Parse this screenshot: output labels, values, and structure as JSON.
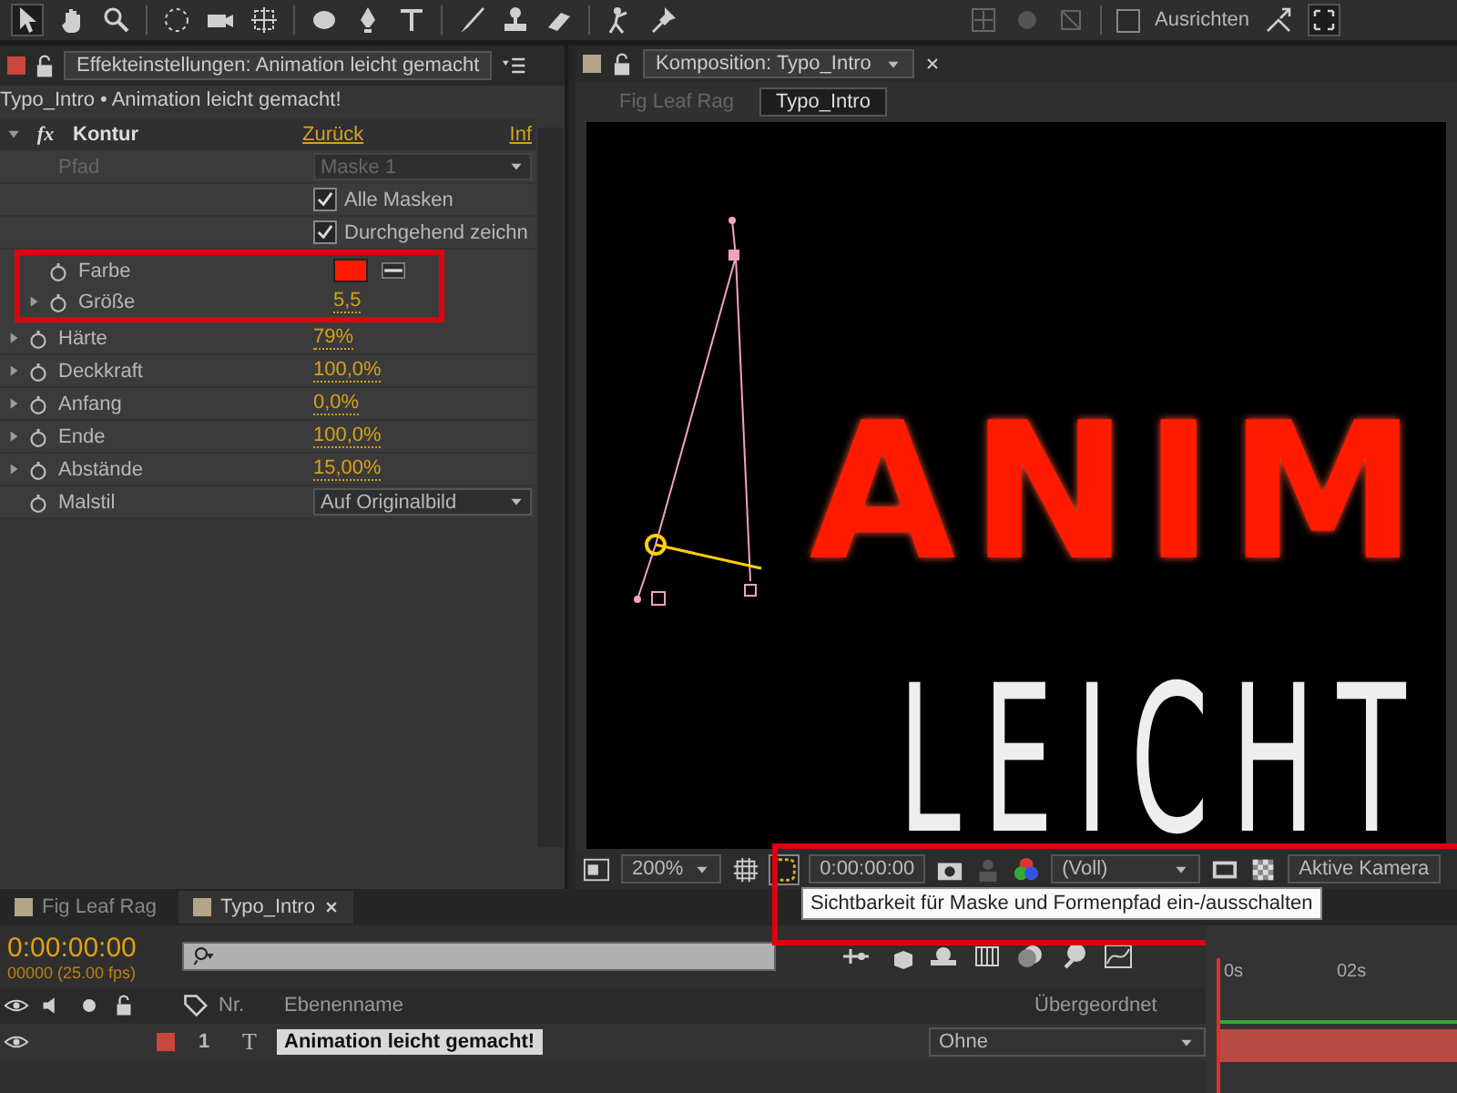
{
  "toolbar": {
    "align": {
      "label": "Ausrichten",
      "checked": false
    }
  },
  "effects_panel": {
    "tab": "Effekteinstellungen: Animation leicht gemacht",
    "breadcrumb": "Typo_Intro • Animation leicht gemacht!",
    "effect": {
      "fx_label": "fx",
      "name": "Kontur",
      "reset": "Zurück",
      "about": "Inf",
      "expanded": true
    },
    "rows": [
      {
        "kind": "dropdown",
        "label": "Pfad",
        "value": "Maske 1",
        "disabled": true,
        "stopwatch": false,
        "annotated": false
      },
      {
        "kind": "checkbox",
        "label": "Alle Masken",
        "checked": true,
        "stopwatch": false,
        "annotated": false
      },
      {
        "kind": "checkbox",
        "label": "Durchgehend zeichn",
        "checked": true,
        "stopwatch": false,
        "annotated": false
      },
      {
        "kind": "color",
        "label": "Farbe",
        "color": "#ff1a00",
        "stopwatch": true,
        "annotated": true
      },
      {
        "kind": "value",
        "label": "Größe",
        "value": "5,5",
        "stopwatch": true,
        "annotated": true
      },
      {
        "kind": "value",
        "label": "Härte",
        "value": "79%",
        "stopwatch": true,
        "annotated": false
      },
      {
        "kind": "value",
        "label": "Deckkraft",
        "value": "100,0%",
        "stopwatch": true,
        "annotated": false
      },
      {
        "kind": "value",
        "label": "Anfang",
        "value": "0,0%",
        "stopwatch": true,
        "annotated": false
      },
      {
        "kind": "value",
        "label": "Ende",
        "value": "100,0%",
        "stopwatch": true,
        "annotated": false
      },
      {
        "kind": "value",
        "label": "Abstände",
        "value": "15,00%",
        "stopwatch": true,
        "annotated": false
      },
      {
        "kind": "dropdown",
        "label": "Malstil",
        "value": "Auf Originalbild",
        "disabled": false,
        "stopwatch": true,
        "annotated": false
      }
    ]
  },
  "composition": {
    "tab": "Komposition: Typo_Intro",
    "subtabs": [
      {
        "label": "Fig Leaf Rag",
        "selected": false
      },
      {
        "label": "Typo_Intro",
        "selected": true
      }
    ],
    "viewer_lines": [
      {
        "text": "ANIM",
        "selected": true
      },
      {
        "text": "LEICHT",
        "selected": false
      }
    ],
    "footer": {
      "zoom": "200%",
      "mask_visibility_on": true,
      "time": "0:00:00:00",
      "resolution": "(Voll)",
      "camera": "Aktive Kamera",
      "annotated": true
    },
    "tooltip": "Sichtbarkeit für Maske und Formenpfad ein-/ausschalten"
  },
  "timeline": {
    "tabs": [
      {
        "label": "Fig Leaf Rag",
        "selected": false
      },
      {
        "label": "Typo_Intro",
        "selected": true
      }
    ],
    "time": "0:00:00:00",
    "fps": "00000 (25.00 fps)",
    "columns": [
      "Nr.",
      "Ebenenname",
      "Übergeordnet"
    ],
    "layers": [
      {
        "number": "1",
        "type": "T",
        "name": "Animation leicht gemacht!",
        "parent": "Ohne",
        "color": "#c8463c"
      }
    ],
    "ruler": [
      "0s",
      "02s"
    ]
  }
}
